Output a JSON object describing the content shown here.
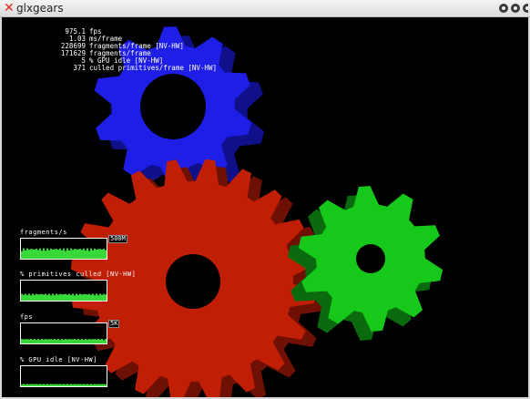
{
  "window": {
    "title": "glxgears",
    "title_icon": "x-logo-icon",
    "buttons": [
      "minimize-button",
      "maximize-button",
      "close-button"
    ]
  },
  "hud": {
    "rows": [
      {
        "value": "975.1",
        "label": "fps"
      },
      {
        "value": "1.03",
        "label": "ms/frame"
      },
      {
        "value": "228699",
        "label": "fragments/frame [NV-HW]"
      },
      {
        "value": "171629",
        "label": "fragments/frame"
      },
      {
        "value": "5",
        "label": "% GPU idle [NV-HW]"
      },
      {
        "value": "371",
        "label": "culled primitives/frame [NV-HW]"
      }
    ]
  },
  "graphs": [
    {
      "label": "fragments/s",
      "max": "500M",
      "level": 0.45
    },
    {
      "label": "% primitives culled [NV-HW]",
      "max": "",
      "level": 0.3
    },
    {
      "label": "fps",
      "max": "5K",
      "level": 0.2
    },
    {
      "label": "% GPU idle [NV-HW]",
      "max": "",
      "level": 0.1
    }
  ],
  "colors": {
    "red_gear": "#c01e05",
    "green_gear": "#16c81a",
    "blue_gear": "#1e1ee6",
    "graph_fill": "#38d838",
    "background": "#000000"
  }
}
